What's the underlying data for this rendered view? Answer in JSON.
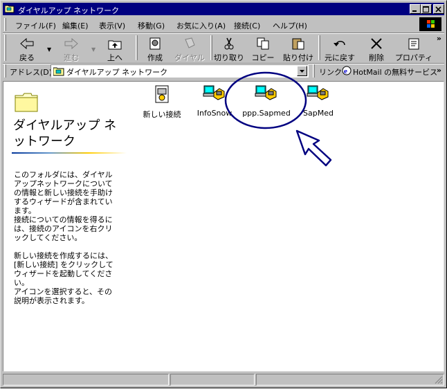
{
  "window": {
    "title": "ダイヤルアップ ネットワーク",
    "buttons": [
      "minimize",
      "maximize",
      "close"
    ]
  },
  "menubar": {
    "items": [
      {
        "label": "ファイル(F)"
      },
      {
        "label": "編集(E)"
      },
      {
        "label": "表示(V)"
      },
      {
        "label": "移動(G)"
      },
      {
        "label": "お気に入り(A)"
      },
      {
        "label": "接続(C)"
      },
      {
        "label": "ヘルプ(H)"
      }
    ]
  },
  "toolbar": {
    "back": "戻る",
    "forward": "進む",
    "up": "上へ",
    "create": "作成",
    "dial": "ダイヤル",
    "cut": "切り取り",
    "copy": "コピー",
    "paste": "貼り付け",
    "undo": "元に戻す",
    "delete": "削除",
    "properties": "プロパティ",
    "more": "»"
  },
  "addressbar": {
    "label": "アドレス(D)",
    "value": "ダイヤルアップ ネットワーク",
    "links_label": "リンク",
    "link_item": "HotMail の無料サービス",
    "more": "»"
  },
  "left_panel": {
    "title": "ダイヤルアップ ネットワーク",
    "paragraphs": [
      "このフォルダには、ダイヤルアップネットワークについての情報と新しい接続を手助けするウィザードが含まれています。",
      "接続についての情報を得るには、接続のアイコンを右クリックしてください。",
      "新しい接続を作成するには、[新しい接続] をクリックしてウィザードを起動してください。",
      "アイコンを選択すると、その説明が表示されます。"
    ]
  },
  "icons": [
    {
      "label": "新しい接続",
      "icon": "new-connection-icon"
    },
    {
      "label": "InfoSnow",
      "icon": "connection-icon"
    },
    {
      "label": "ppp.Sapmed",
      "icon": "connection-icon"
    },
    {
      "label": "SapMed",
      "icon": "connection-icon"
    }
  ],
  "colors": {
    "titlebar": "#000080",
    "annotation": "#000080",
    "face": "#c0c0c0"
  }
}
